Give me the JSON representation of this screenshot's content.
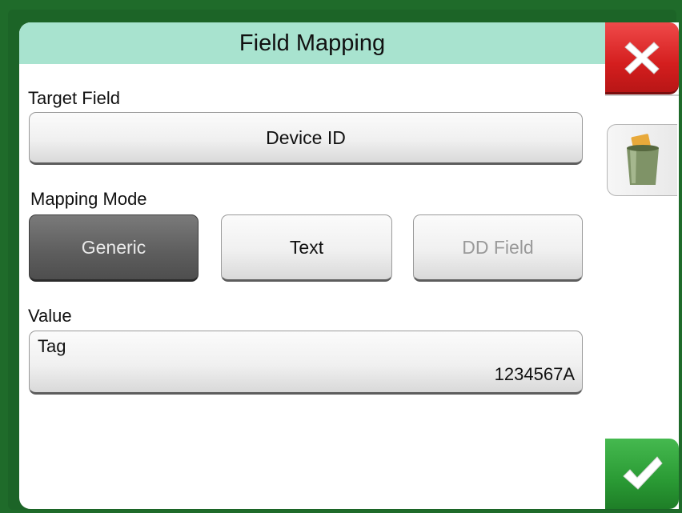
{
  "title": "Field Mapping",
  "target_field": {
    "label": "Target Field",
    "value": "Device ID"
  },
  "mapping_mode": {
    "label": "Mapping Mode",
    "options": [
      "Generic",
      "Text",
      "DD Field"
    ],
    "selected": "Generic",
    "disabled": [
      "DD Field"
    ]
  },
  "value_field": {
    "label": "Value",
    "name": "Tag",
    "value": "1234567A"
  },
  "icons": {
    "close": "close-x-icon",
    "delete": "trash-icon",
    "accept": "checkmark-icon"
  },
  "colors": {
    "frame": "#1c6427",
    "title_bar": "#a8e3cf",
    "close": "#d41e1e",
    "accept": "#2a9a34",
    "selected_button": "#5d5d5d"
  }
}
